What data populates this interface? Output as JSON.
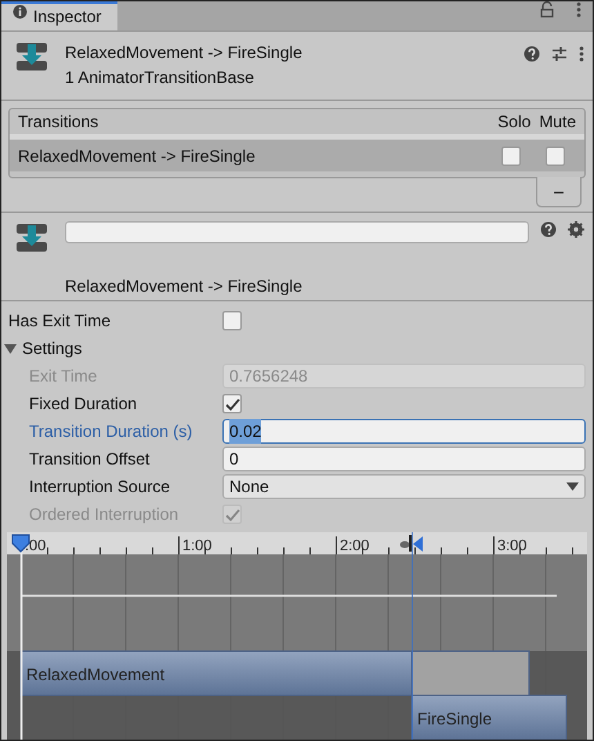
{
  "tab": {
    "label": "Inspector",
    "selected": true
  },
  "header": {
    "title": "RelaxedMovement -> FireSingle",
    "subtitle": "1 AnimatorTransitionBase"
  },
  "transitions": {
    "columns": [
      "Transitions",
      "Solo",
      "Mute"
    ],
    "rows": [
      {
        "name": "RelaxedMovement -> FireSingle",
        "selected": true,
        "solo": false,
        "mute": false
      }
    ],
    "remove_button": "−"
  },
  "transition": {
    "label": "RelaxedMovement -> FireSingle"
  },
  "properties": [
    {
      "kind": "checkbox",
      "label": "Has Exit Time",
      "checked": false,
      "disabled": false
    },
    {
      "kind": "foldout",
      "label": "Settings",
      "expanded": true,
      "disabled": false,
      "children": [
        {
          "kind": "number",
          "label": "Exit Time",
          "value": "0.7656248",
          "disabled": true,
          "focused": false
        },
        {
          "kind": "checkbox",
          "label": "Fixed Duration",
          "checked": true,
          "disabled": false
        },
        {
          "kind": "number",
          "label": "Transition Duration (s)",
          "value": "0.02",
          "disabled": false,
          "focused": true
        },
        {
          "kind": "number",
          "label": "Transition Offset",
          "value": "0",
          "disabled": false,
          "focused": false
        },
        {
          "kind": "dropdown",
          "label": "Interruption Source",
          "value": "None",
          "disabled": false
        },
        {
          "kind": "checkbox",
          "label": "Ordered Interruption",
          "checked": true,
          "disabled": true
        }
      ]
    }
  ],
  "timeline": {
    "ticks": [
      ":00",
      "1:00",
      "2:00",
      "3:00"
    ],
    "clips": [
      {
        "name": "RelaxedMovement"
      },
      {
        "name": "FireSingle"
      }
    ]
  }
}
